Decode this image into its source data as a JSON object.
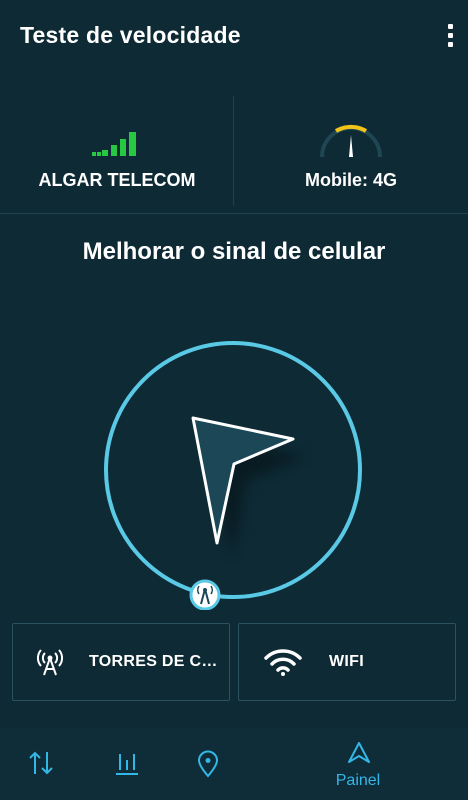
{
  "app": {
    "title": "Teste de velocidade"
  },
  "info": {
    "carrier": "ALGAR TELECOM",
    "network": "Mobile: 4G",
    "signal_color": "#26c941",
    "gauge_color": "#f0c419"
  },
  "main": {
    "title": "Melhorar o sinal de celular",
    "ring_color": "#59c9e6"
  },
  "cards": [
    {
      "label": "TORRES DE CELULAR",
      "icon": "cell-tower-icon"
    },
    {
      "label": "WIFI",
      "icon": "wifi-icon"
    }
  ],
  "nav": {
    "items": [
      {
        "icon": "transfer-arrows-icon"
      },
      {
        "icon": "bar-chart-icon"
      },
      {
        "icon": "location-pin-icon"
      },
      {
        "icon": "navigation-arrow-icon",
        "label": "Painel",
        "active": true
      }
    ],
    "accent": "#33b7e7"
  }
}
